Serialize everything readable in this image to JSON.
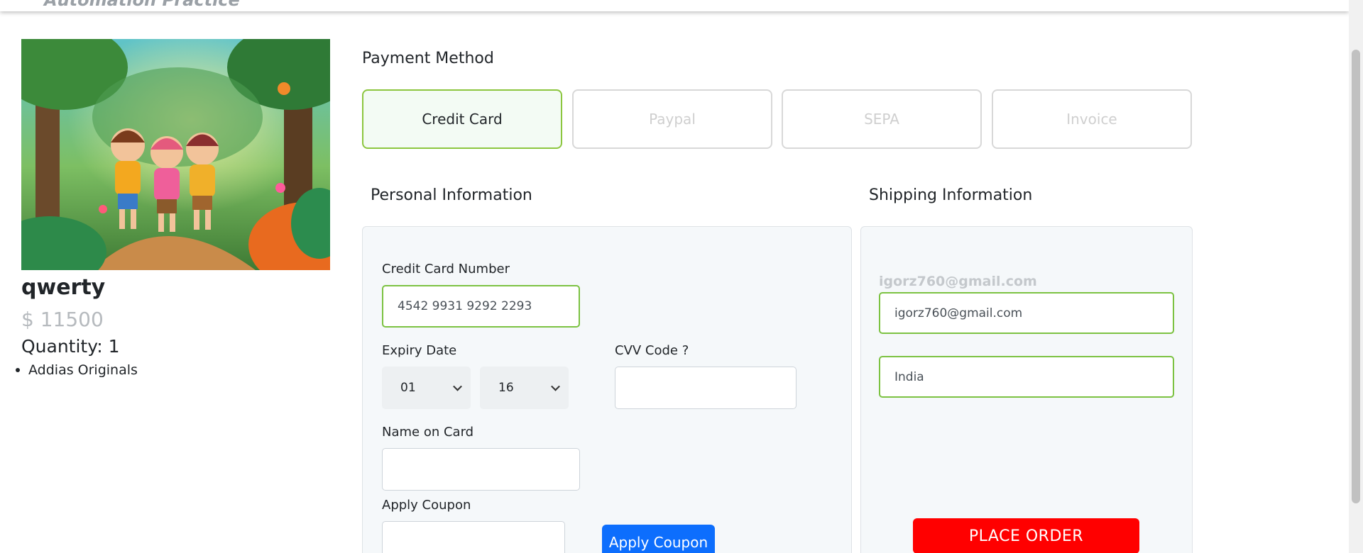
{
  "header": {
    "brand": "Automation Practice"
  },
  "product": {
    "image_alt": "Children walking in a jungle illustration",
    "name": "qwerty",
    "price": "$ 11500",
    "quantity": "Quantity: 1",
    "features": [
      "Addias Originals"
    ]
  },
  "payment": {
    "title": "Payment Method",
    "methods": [
      {
        "label": "Credit Card",
        "active": true
      },
      {
        "label": "Paypal",
        "active": false
      },
      {
        "label": "SEPA",
        "active": false
      },
      {
        "label": "Invoice",
        "active": false
      }
    ]
  },
  "personal": {
    "title": "Personal Information",
    "card_number_label": "Credit Card Number",
    "card_number_value": "4542 9931 9292 2293",
    "expiry_label": "Expiry Date",
    "expiry_month": "01",
    "expiry_year": "16",
    "cvv_label": "CVV Code ?",
    "cvv_value": "",
    "name_label": "Name on Card",
    "name_value": "",
    "coupon_label": "Apply Coupon",
    "coupon_value": "",
    "coupon_button": "Apply Coupon"
  },
  "shipping": {
    "title": "Shipping Information",
    "email_hint": "igorz760@gmail.com",
    "email_value": "igorz760@gmail.com",
    "country_value": "India",
    "place_order": "PLACE ORDER"
  },
  "colors": {
    "valid_border": "#7cc242",
    "active_method_bg": "#f3fbf4",
    "coupon_button": "#0d6efd",
    "order_button": "#ff0000"
  }
}
